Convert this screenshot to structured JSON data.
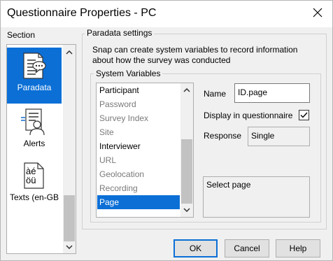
{
  "window": {
    "title": "Questionnaire Properties - PC",
    "close_glyph": "✕"
  },
  "section": {
    "label": "Section",
    "items": [
      {
        "label": "Paradata",
        "icon": "paradata-icon",
        "selected": true
      },
      {
        "label": "Alerts",
        "icon": "alerts-icon",
        "selected": false
      },
      {
        "label": "Texts (en-GB",
        "icon": "texts-icon",
        "icon_text": "àé\nöü",
        "selected": false
      }
    ]
  },
  "paradata": {
    "group_title": "Paradata settings",
    "description": "Snap can create system variables to record information about how the survey was conducted",
    "system_variables": {
      "title": "System Variables",
      "items": [
        {
          "label": "Participant",
          "enabled": true,
          "selected": false
        },
        {
          "label": "Password",
          "enabled": false,
          "selected": false
        },
        {
          "label": "Survey Index",
          "enabled": false,
          "selected": false
        },
        {
          "label": "Site",
          "enabled": false,
          "selected": false
        },
        {
          "label": "Interviewer",
          "enabled": true,
          "selected": false
        },
        {
          "label": "URL",
          "enabled": false,
          "selected": false
        },
        {
          "label": "Geolocation",
          "enabled": false,
          "selected": false
        },
        {
          "label": "Recording",
          "enabled": false,
          "selected": false
        },
        {
          "label": "Page",
          "enabled": true,
          "selected": true
        }
      ]
    },
    "name_label": "Name",
    "name_value": "ID.page",
    "display_label": "Display in questionnaire",
    "display_checked": true,
    "response_label": "Response",
    "response_value": "Single",
    "info_text": "Select page"
  },
  "buttons": {
    "ok": "OK",
    "cancel": "Cancel",
    "help": "Help"
  },
  "colors": {
    "selection": "#0b6fd6",
    "disabled_text": "#7a7a7a",
    "background": "#f0f0f0"
  }
}
